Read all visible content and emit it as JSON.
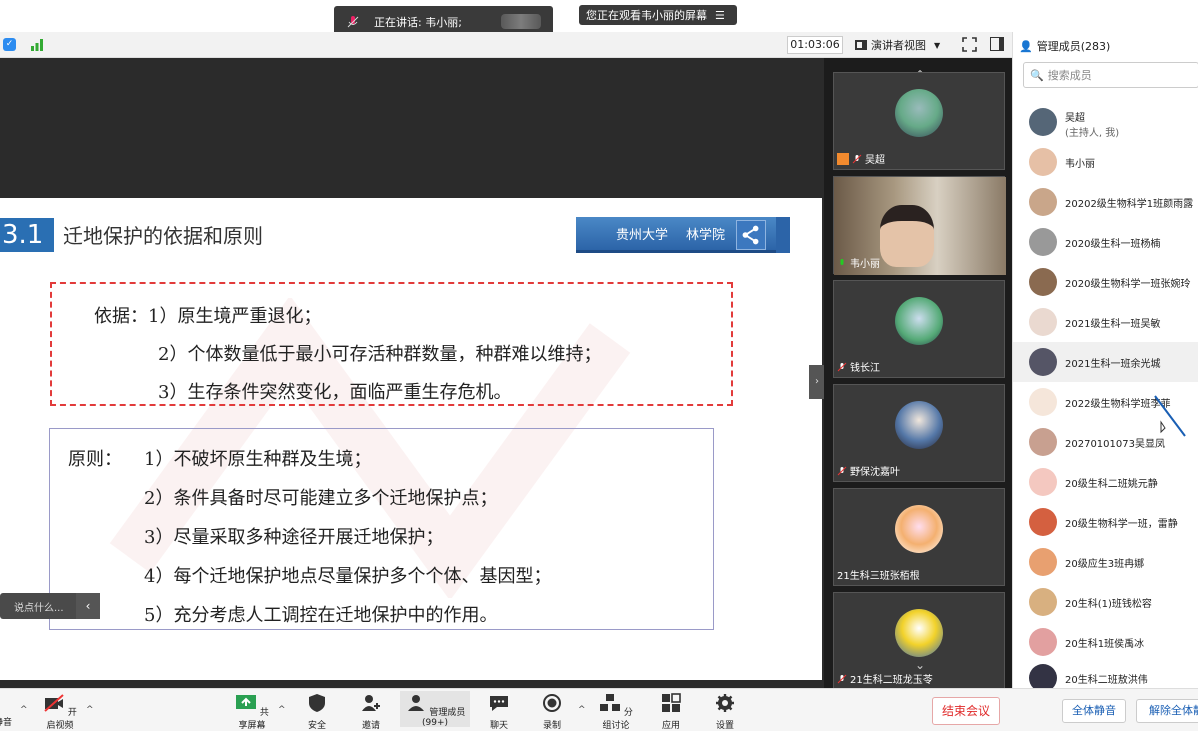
{
  "banner": {
    "speaking": "正在讲话: 韦小丽;",
    "watching": "您正在观看韦小丽的屏幕"
  },
  "toolbar": {
    "timer": "01:03:06",
    "view_label": "演讲者视图"
  },
  "slide": {
    "section_number": "3.1",
    "section_title": "迁地保护的依据和原则",
    "university": "贵州大学",
    "college": "林学院",
    "basis": [
      "依据：1）原生境严重退化；",
      "2）个体数量低于最小可存活种群数量，种群难以维持；",
      "3）生存条件突然变化，面临严重生存危机。"
    ],
    "principles_head": "原则：",
    "principles": [
      "1）不破坏原生种群及生境；",
      "2）条件具备时尽可能建立多个迁地保护点；",
      "3）尽量采取多种途径开展迁地保护；",
      "4）每个迁地保护地点尽量保护多个个体、基因型；",
      "5）充分考虑人工调控在迁地保护中的作用。"
    ]
  },
  "chat_popup": "说点什么...",
  "gallery": [
    {
      "name": "吴超",
      "host": true
    },
    {
      "name": "韦小丽",
      "host": false
    },
    {
      "name": "钱长江",
      "host": false
    },
    {
      "name": "野保沈嘉叶",
      "host": false
    },
    {
      "name": "21生科三班张栢根",
      "host": false
    },
    {
      "name": "21生科二班龙玉苓",
      "host": false
    }
  ],
  "panel": {
    "title": "管理成员(283)",
    "search_placeholder": "搜索成员",
    "members": [
      {
        "name": "吴超",
        "sub": "(主持人, 我)"
      },
      {
        "name": "韦小丽",
        "sub": ""
      },
      {
        "name": "20202级生物科学1班颜雨露",
        "sub": ""
      },
      {
        "name": "2020级生科一班杨楠",
        "sub": ""
      },
      {
        "name": "2020级生物科学一班张婉玲",
        "sub": ""
      },
      {
        "name": "2021级生科一班吴敏",
        "sub": ""
      },
      {
        "name": "2021生科一班余光城",
        "sub": ""
      },
      {
        "name": "2022级生物科学班李菲",
        "sub": ""
      },
      {
        "name": "20270101073吴显凤",
        "sub": ""
      },
      {
        "name": "20级生科二班姚元静",
        "sub": ""
      },
      {
        "name": "20级生物科学一班，雷静",
        "sub": ""
      },
      {
        "name": "20级应生3班冉娜",
        "sub": ""
      },
      {
        "name": "20生科(1)班钱松容",
        "sub": ""
      },
      {
        "name": "20生科1班侯禹冰",
        "sub": ""
      },
      {
        "name": "20生科二班敖洪伟",
        "sub": ""
      }
    ]
  },
  "bottom": {
    "mute": "静音",
    "video": "开启视频",
    "share": "共享屏幕",
    "security": "安全",
    "invite": "邀请",
    "members": "管理成员(99+)",
    "chat": "聊天",
    "record": "录制",
    "breakout": "分组讨论",
    "apps": "应用",
    "settings": "设置",
    "end": "结束会议",
    "mute_all": "全体静音",
    "unmute_all": "解除全体静音"
  },
  "colors": {
    "accent": "#2a6fb3",
    "end_red": "#e02a2a",
    "dashed_red": "#e23b3b"
  }
}
